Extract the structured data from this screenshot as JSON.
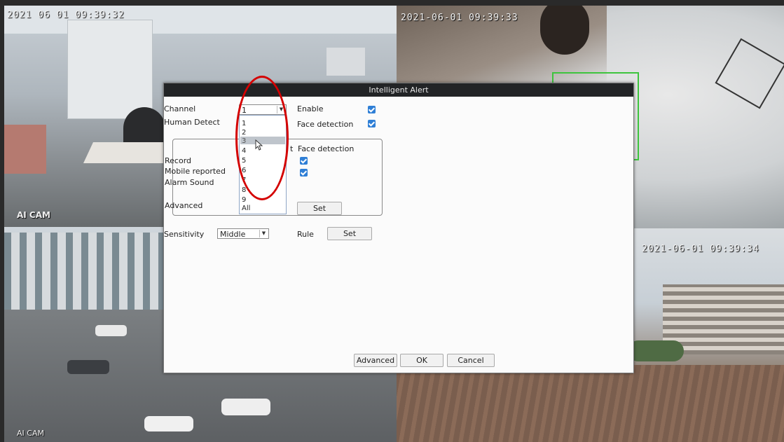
{
  "cameras": {
    "top_left": {
      "timestamp": "2021 06 01 09:39:32",
      "name": "AI CAM"
    },
    "top_right": {
      "timestamp": "2021-06-01 09:39:33"
    },
    "bottom_left": {
      "timestamp": "",
      "name": "AI CAM"
    },
    "bottom_right": {
      "timestamp": "2021-06-01 09:39:34"
    }
  },
  "dialog": {
    "title": "Intelligent Alert",
    "channel": {
      "label": "Channel",
      "value": "1"
    },
    "enable": {
      "label": "Enable",
      "checked": true
    },
    "human_detect": {
      "label": "Human Detect",
      "partial_label": "t"
    },
    "face_detection": {
      "label": "Face detection",
      "checked": true
    },
    "group": {
      "title": "Face detection",
      "record": {
        "label": "Record",
        "checked": true
      },
      "mobile_reported": {
        "label": "Mobile reported",
        "checked": true
      },
      "alarm_sound": {
        "label": "Alarm Sound"
      },
      "advanced": {
        "label": "Advanced",
        "button": "Set"
      }
    },
    "channel_options": [
      "1",
      "2",
      "3",
      "4",
      "5",
      "6",
      "7",
      "8",
      "9",
      "All"
    ],
    "highlighted_option": "3",
    "sensitivity": {
      "label": "Sensitivity",
      "value": "Middle"
    },
    "rule": {
      "label": "Rule",
      "button": "Set"
    },
    "buttons": {
      "advanced": "Advanced",
      "ok": "OK",
      "cancel": "Cancel"
    }
  },
  "colors": {
    "checkbox": "#2f7fd6",
    "annotation": "#d40000",
    "face_box": "#3ec43e",
    "titlebar": "#222426"
  }
}
